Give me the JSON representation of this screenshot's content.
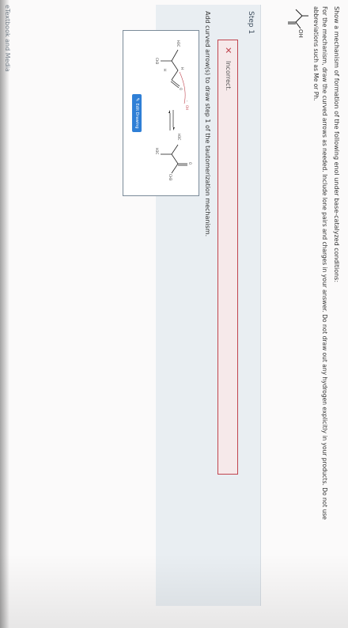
{
  "question": {
    "title": "Show a mechanism of formation of the following enol under base-catalyzed conditions:",
    "instructions": "For the mechanism, draw the curved arrows as needed. Include lone pairs and charges in your answer. Do not draw out any hydrogen explicitly in your products. Do not use abbreviations such as Me or Ph.",
    "molecule_label": "OH"
  },
  "step": {
    "label": "Step 1",
    "feedback_status": "Incorrect.",
    "instruction": "Add curved arrow(s) to draw step 1 of the tautomerization mechanism.",
    "edit_button": "Edit Drawing",
    "drawing_labels": {
      "h3c_left": "H3C",
      "ch3_left": "CH3",
      "h_a": "H",
      "h_b": "H",
      "o_left": "O",
      "oh_minus": "OH",
      "charge_minus": "-",
      "h3c_right_top": "H3C",
      "h3c_right_bottom": "H3C",
      "o_right": "O",
      "ch3_right": "CH3"
    }
  },
  "footer": {
    "branding": "eTextbook and Media"
  }
}
